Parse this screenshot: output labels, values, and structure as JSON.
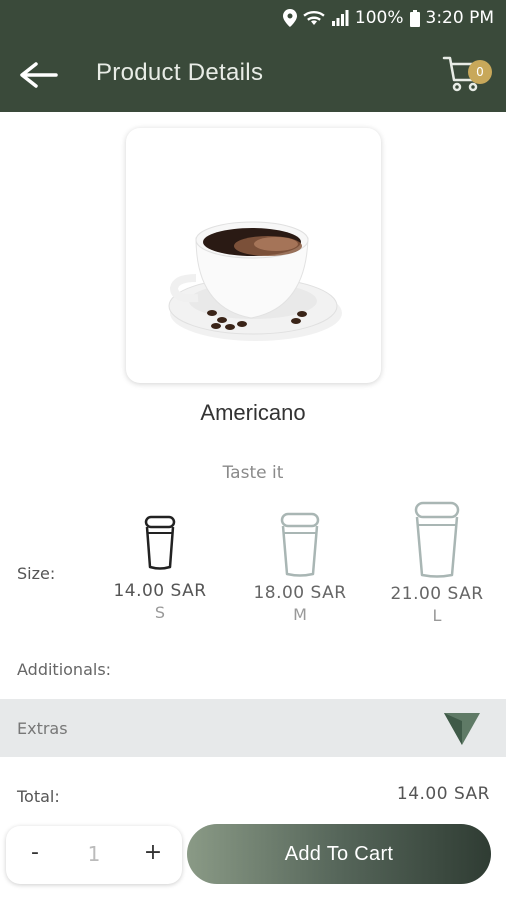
{
  "status_bar": {
    "battery_percent": "100%",
    "time": "3:20 PM",
    "icons": [
      "location-icon",
      "wifi-icon",
      "signal-icon",
      "battery-icon"
    ]
  },
  "header": {
    "title": "Product Details",
    "back_icon": "arrow-left-icon",
    "cart_icon": "cart-icon",
    "cart_count": "0"
  },
  "product": {
    "name": "Americano",
    "subtitle": "Taste it",
    "image_icon": "coffee-cup-image"
  },
  "size": {
    "label": "Size:",
    "options": [
      {
        "price": "14.00 SAR",
        "code": "S",
        "selected": true
      },
      {
        "price": "18.00 SAR",
        "code": "M",
        "selected": false
      },
      {
        "price": "21.00 SAR",
        "code": "L",
        "selected": false
      }
    ]
  },
  "additionals": {
    "label": "Additionals:",
    "extras_label": "Extras",
    "toggle_icon": "chevron-down-icon"
  },
  "total": {
    "label": "Total:",
    "value": "14.00 SAR"
  },
  "footer": {
    "minus_label": "-",
    "quantity": "1",
    "plus_label": "+",
    "add_to_cart_label": "Add To Cart"
  },
  "colors": {
    "header_bg": "#3a4a3a",
    "accent": "#c8a85a",
    "button_dark": "#2f3c33",
    "cup_selected": "#222222",
    "cup_unselected": "#a9b6b4"
  }
}
